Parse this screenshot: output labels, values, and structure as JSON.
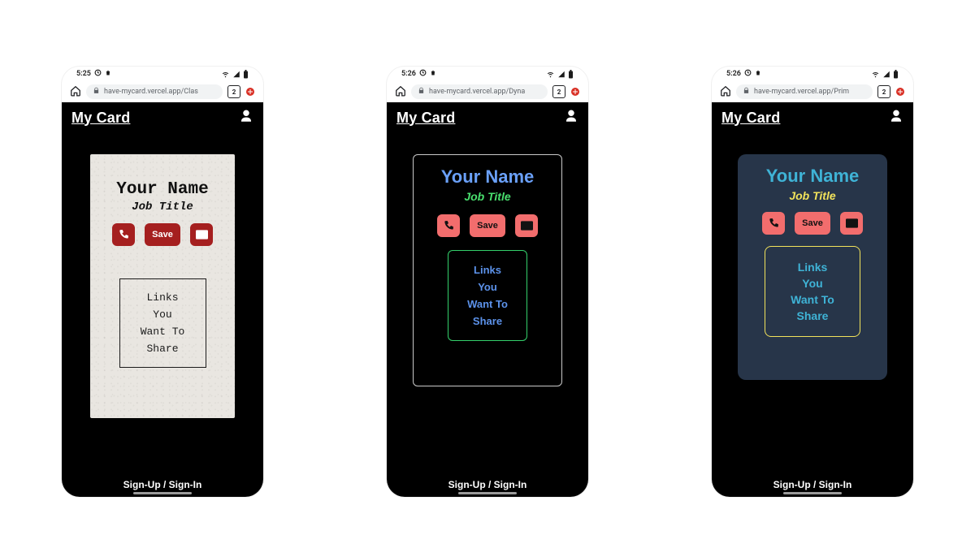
{
  "app": {
    "title": "My Card",
    "footer": "Sign-Up / Sign-In"
  },
  "card_template": {
    "name": "Your Name",
    "title": "Job Title",
    "save_label": "Save",
    "links": [
      "Links",
      "You",
      "Want To",
      "Share"
    ]
  },
  "chrome": {
    "tab_count": "2"
  },
  "phones": [
    {
      "variant": "classic",
      "status_time": "5:25",
      "url": "have-mycard.vercel.app/Clas"
    },
    {
      "variant": "dynamic",
      "status_time": "5:26",
      "url": "have-mycard.vercel.app/Dyna"
    },
    {
      "variant": "primary",
      "status_time": "5:26",
      "url": "have-mycard.vercel.app/Prim"
    }
  ]
}
